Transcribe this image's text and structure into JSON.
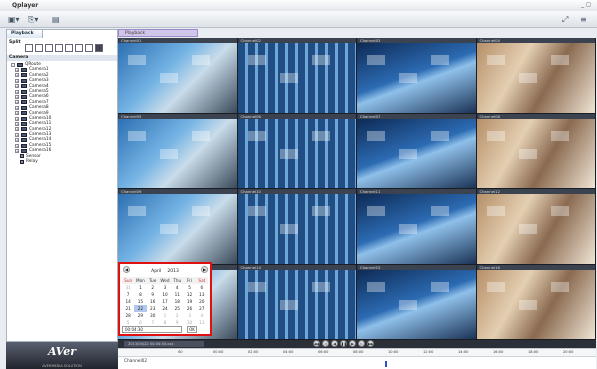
{
  "app": {
    "title": "Qplayer",
    "window_controls": "_ ◻"
  },
  "left": {
    "tab": "Playback",
    "split_label": "Split",
    "camera_header": "Camera",
    "root": "QRoute",
    "cameras": [
      "Camera1",
      "Camera2",
      "Camera3",
      "Camera4",
      "Camera5",
      "Camera6",
      "Camera7",
      "Camera8",
      "Camera9",
      "Camera10",
      "Camera11",
      "Camera12",
      "Camera13",
      "Camera14",
      "Camera15",
      "Camera16"
    ],
    "extras": [
      "Sensor",
      "Relay"
    ]
  },
  "video_tab": "Playback",
  "channels": [
    "Channel01",
    "Channel02",
    "Channel03",
    "Channel04",
    "Channel05",
    "Channel06",
    "Channel07",
    "Channel08",
    "Channel09",
    "Channel10",
    "Channel11",
    "Channel12",
    "Channel13",
    "Channel14",
    "Channel15",
    "Channel16"
  ],
  "calendar": {
    "month": "April",
    "year": "2013",
    "weekdays": [
      "Sun",
      "Mon",
      "Tue",
      "Wed",
      "Thu",
      "Fri",
      "Sat"
    ],
    "weeks": [
      [
        "31",
        "1",
        "2",
        "3",
        "4",
        "5",
        "6"
      ],
      [
        "7",
        "8",
        "9",
        "10",
        "11",
        "12",
        "13"
      ],
      [
        "14",
        "15",
        "16",
        "17",
        "18",
        "19",
        "20"
      ],
      [
        "21",
        "22",
        "23",
        "24",
        "25",
        "26",
        "27"
      ],
      [
        "28",
        "29",
        "30",
        "1",
        "2",
        "3",
        "4"
      ],
      [
        "5",
        "6",
        "7",
        "8",
        "9",
        "10",
        "11"
      ]
    ],
    "time": "00:04:30",
    "ok": "OK"
  },
  "playback": {
    "time": "2013/04/22 00:04:30.xxx"
  },
  "timeline": {
    "ticks": [
      "00",
      "00:00",
      "02:00",
      "04:00",
      "06:00",
      "08:00",
      "10:00",
      "12:00",
      "14:00",
      "16:00",
      "18:00",
      "20:00",
      "22:00"
    ],
    "channel": "Channel02"
  },
  "logo": {
    "text": "AVer",
    "sub": "AVERMEDIA SOLUTION"
  },
  "colors": {
    "highlight": "#e01010",
    "accent": "#2a4fd0"
  }
}
